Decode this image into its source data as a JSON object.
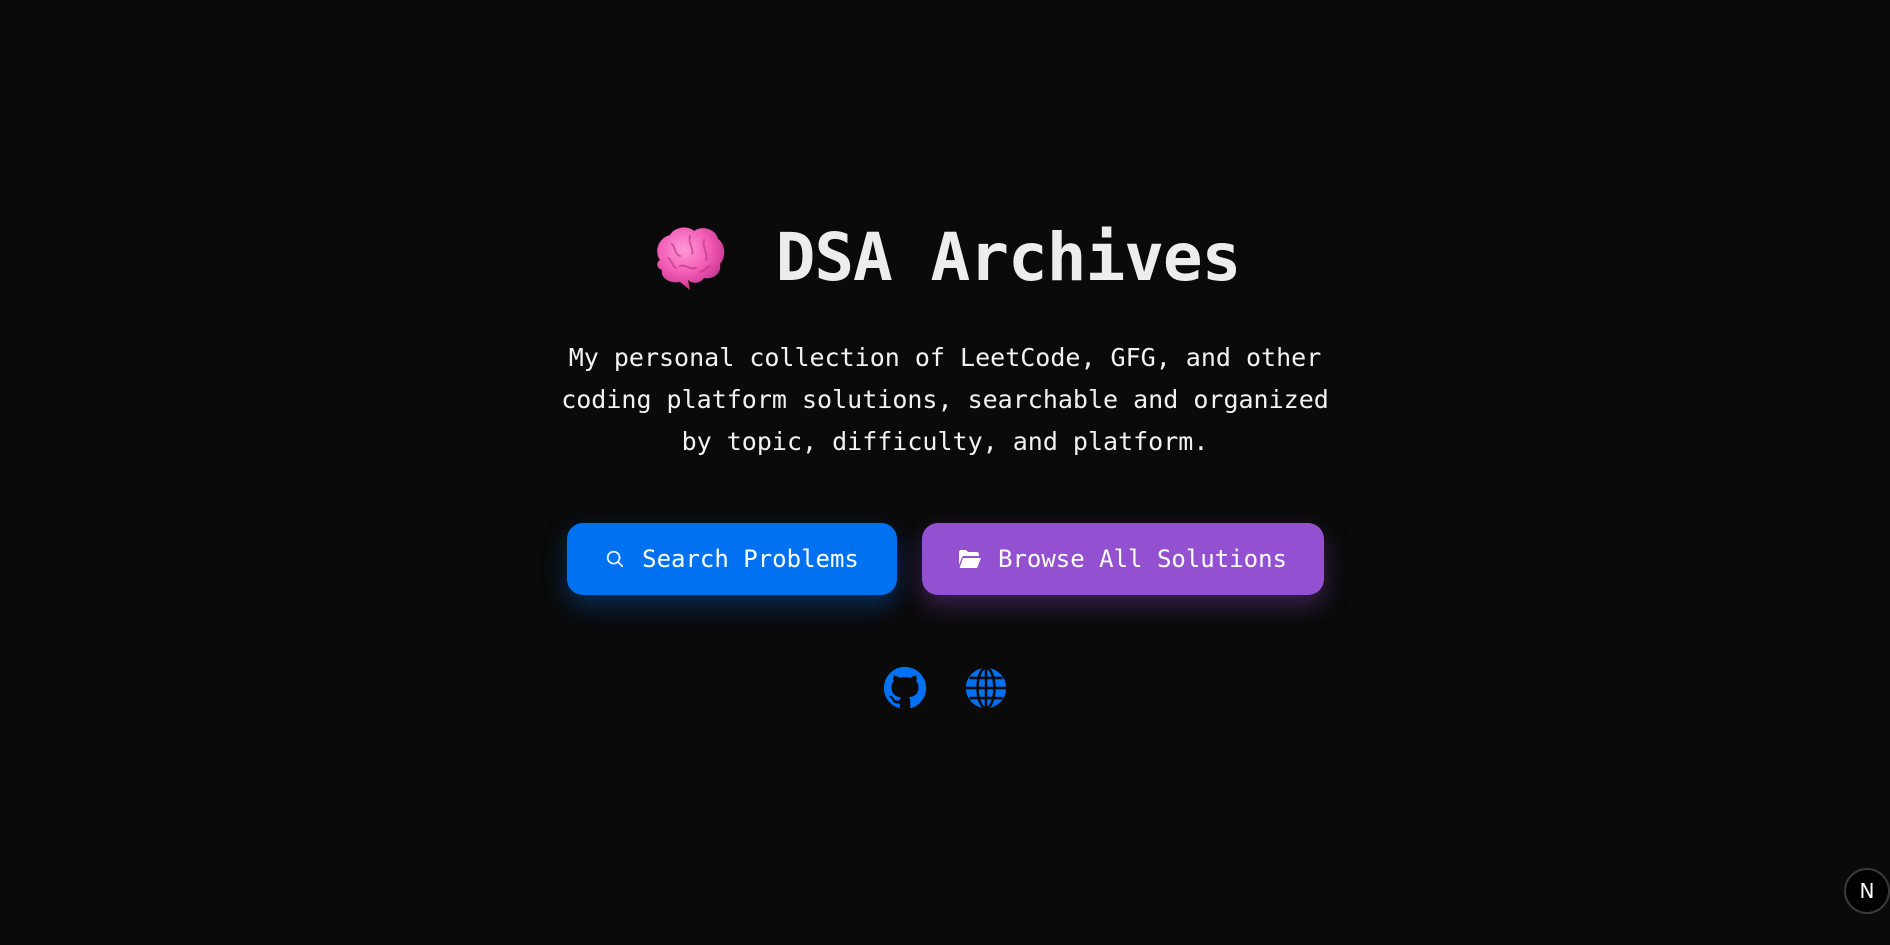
{
  "hero": {
    "emoji_icon": "brain-icon",
    "title": "DSA Archives",
    "description_lines": [
      "My personal collection of LeetCode, GFG, and other",
      "coding platform solutions, searchable and organized",
      "by topic, difficulty, and platform."
    ]
  },
  "buttons": {
    "search": {
      "label": "Search Problems",
      "icon": "search-icon",
      "color": "#0071f0"
    },
    "browse": {
      "label": "Browse All Solutions",
      "icon": "folder-open-icon",
      "color": "#9350d0"
    }
  },
  "socials": [
    {
      "icon": "github-icon",
      "color": "#0071f0"
    },
    {
      "icon": "globe-icon",
      "color": "#0071f0"
    }
  ],
  "dev_badge": {
    "label": "N"
  },
  "colors": {
    "background": "#0a0a0a",
    "text": "#ededed"
  }
}
